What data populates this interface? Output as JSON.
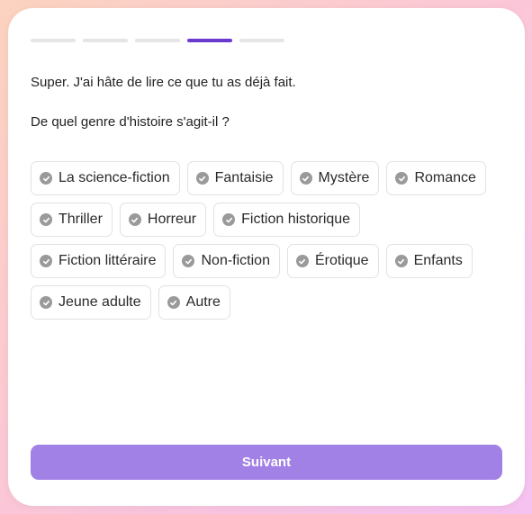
{
  "progress": {
    "total_steps": 5,
    "current_step": 4
  },
  "messages": {
    "line1": "Super. J'ai hâte de lire ce que tu as déjà fait.",
    "line2": "De quel genre d'histoire s'agit-il ?"
  },
  "genres": [
    "La science-fiction",
    "Fantaisie",
    "Mystère",
    "Romance",
    "Thriller",
    "Horreur",
    "Fiction historique",
    "Fiction littéraire",
    "Non-fiction",
    "Érotique",
    "Enfants",
    "Jeune adulte",
    "Autre"
  ],
  "next_button": {
    "label": "Suivant"
  },
  "colors": {
    "accent": "#6a3ad0",
    "button": "#a281e6",
    "chip_icon": "#9a9a9a"
  },
  "icons": {
    "chip": "check-circle-icon"
  }
}
